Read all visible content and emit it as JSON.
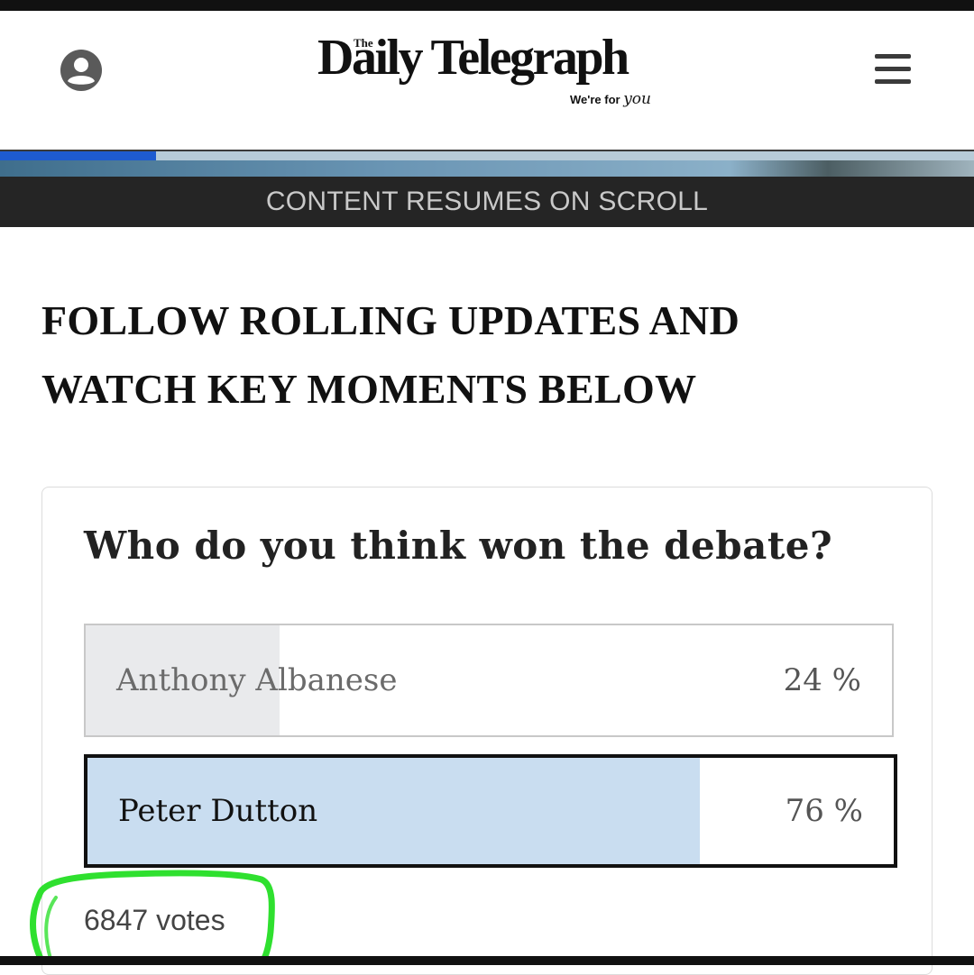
{
  "header": {
    "logo_the": "The",
    "logo_name": "Daily Telegraph",
    "tagline_prefix": "We're for",
    "tagline_script": "you"
  },
  "icons": {
    "account": "user-circle-icon",
    "menu": "hamburger-menu-icon"
  },
  "banner": {
    "text": "CONTENT RESUMES ON SCROLL"
  },
  "progress": {
    "fraction": 0.16,
    "color": "#1e5bd0"
  },
  "headline": {
    "line1": "FOLLOW ROLLING UPDATES AND",
    "line2": "WATCH KEY MOMENTS BELOW"
  },
  "poll": {
    "question": "Who do you think won the debate?",
    "options": [
      {
        "label": "Anthony Albanese",
        "percent_text": "24 %",
        "percent": 24,
        "selected": false
      },
      {
        "label": "Peter Dutton",
        "percent_text": "76 %",
        "percent": 76,
        "selected": true
      }
    ],
    "votes_text": "6847 votes"
  },
  "colors": {
    "annotation": "#2fe02f",
    "selected_fill": "#c9ddf0",
    "unselected_fill": "#e9eaec"
  }
}
